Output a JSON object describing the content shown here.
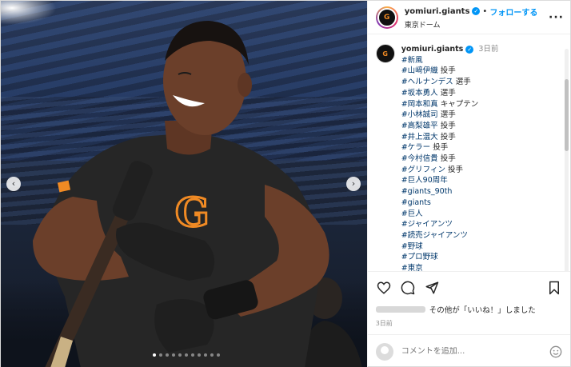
{
  "header": {
    "username": "yomiuri.giants",
    "separator": "•",
    "follow_label": "フォローする",
    "location": "東京ドーム",
    "more_label": "···",
    "avatar_text": "G"
  },
  "caption": {
    "username": "yomiuri.giants",
    "time": "3日前",
    "lines": [
      {
        "tag": "#新風",
        "suffix": ""
      },
      {
        "tag": "#山﨑伊織",
        "suffix": " 投手"
      },
      {
        "tag": "#ヘルナンデス",
        "suffix": " 選手"
      },
      {
        "tag": "#坂本勇人",
        "suffix": " 選手"
      },
      {
        "tag": "#岡本和真",
        "suffix": " キャプテン"
      },
      {
        "tag": "#小林誠司",
        "suffix": " 選手"
      },
      {
        "tag": "#高梨雄平",
        "suffix": " 投手"
      },
      {
        "tag": "#井上温大",
        "suffix": " 投手"
      },
      {
        "tag": "#ケラー",
        "suffix": " 投手"
      },
      {
        "tag": "#今村信貴",
        "suffix": " 投手"
      },
      {
        "tag": "#グリフィン",
        "suffix": " 投手"
      },
      {
        "tag": "#巨人90周年",
        "suffix": ""
      },
      {
        "tag": "#giants_90th",
        "suffix": ""
      },
      {
        "tag": "#giants",
        "suffix": ""
      },
      {
        "tag": "#巨人",
        "suffix": ""
      },
      {
        "tag": "#ジャイアンツ",
        "suffix": ""
      },
      {
        "tag": "#読売ジャイアンツ",
        "suffix": ""
      },
      {
        "tag": "#野球",
        "suffix": ""
      },
      {
        "tag": "#プロ野球",
        "suffix": ""
      },
      {
        "tag": "#東京",
        "suffix": ""
      }
    ]
  },
  "likes": {
    "text": "その他が「いいね！」しました"
  },
  "post_date": "3日前",
  "comment": {
    "placeholder": "コメントを追加..."
  },
  "carousel": {
    "slide_count": 11,
    "active_index": 0
  },
  "icons": [
    "heart-icon",
    "comment-icon",
    "share-icon",
    "bookmark-icon",
    "emoji-icon",
    "chevron-left-icon",
    "chevron-right-icon",
    "verified-icon"
  ],
  "colors": {
    "accent": "#0095f6",
    "giants_orange": "#f08a24"
  }
}
